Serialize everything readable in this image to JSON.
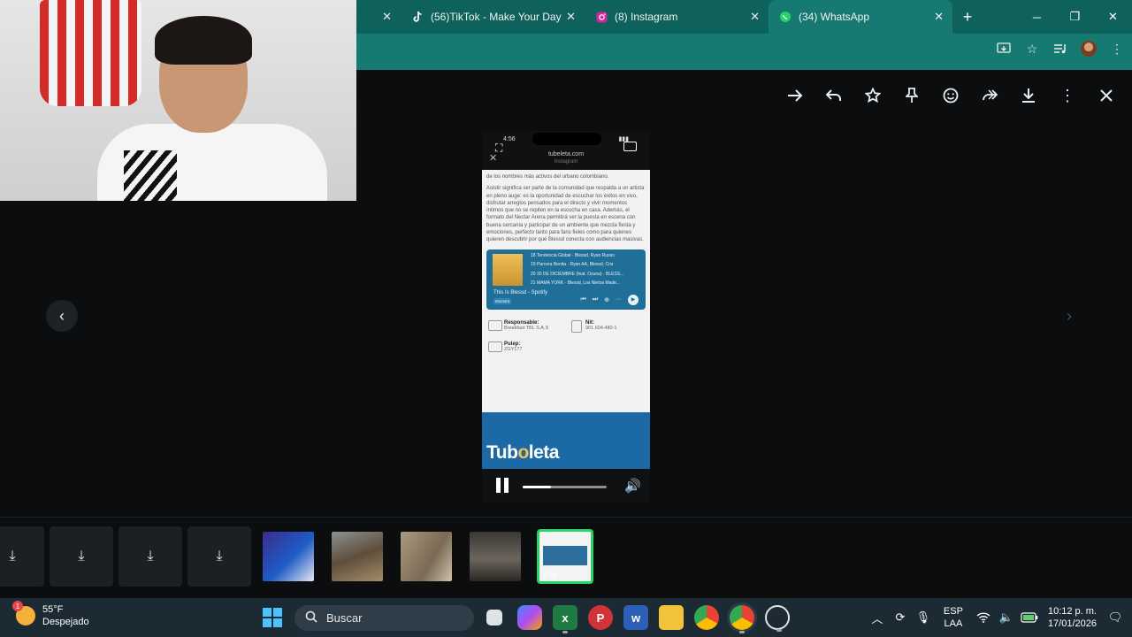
{
  "browser": {
    "tabs": [
      {
        "label": "",
        "icon": "tab-partial",
        "close": "✕"
      },
      {
        "label": "(56)TikTok - Make Your Day",
        "icon": "tiktok-icon",
        "close": "✕"
      },
      {
        "label": "(8) Instagram",
        "icon": "instagram-icon",
        "close": "✕"
      },
      {
        "label": "(34) WhatsApp",
        "icon": "whatsapp-icon",
        "close": "✕",
        "active": true
      }
    ],
    "new_tab": "+",
    "window_controls": [
      "─",
      "❐",
      "✕"
    ]
  },
  "viewer": {
    "actions": [
      "arrow-right-icon",
      "reply-icon",
      "star-icon",
      "pin-icon",
      "emoji-icon",
      "forward-icon",
      "download-icon",
      "more-icon",
      "close-icon"
    ],
    "prev": "‹",
    "next": "›"
  },
  "video": {
    "status_time": "4:56",
    "url": "tubeleta.com",
    "url_sub": "Instagram",
    "para1": "de los nombres más activos del urbano colombiano.",
    "para2": "Asistir significa ser parte de la comunidad que respalda a un artista en pleno auge: es la oportunidad de escuchar los éxitos en vivo, disfrutar arreglos pensados para el directo y vivir momentos íntimos que no se repiten en la escucha en casa. Además, el formato del Nectar Arena permitirá ver la puesta en escena con buena cercanía y participar de un ambiente que mezcla fiesta y emociones, perfecto tanto para fans fieles como para quienes quieren descubrir por qué Blessd conecta con audiencias masivas.",
    "spotify": {
      "tracks": [
        "18  Tendencia Global · Blessd, Ryan Russo",
        "19  Parcera Bonita · Ryan AA, Blessd, Cris",
        "20  30 DE DICIEMBRE (feat. Ozuna) · BLESS...",
        "21  MAMA YORK · Blessd, Los Nietos Made..."
      ],
      "title": "This Is Blessd - Spotify",
      "badge": "Muestra"
    },
    "info": {
      "responsable_label": "Responsable:",
      "responsable_value": "Breakfast TBL S.A.S",
      "nit_label": "Nit:",
      "nit_value": "901.604.480-1",
      "pulep_label": "Pulep:",
      "pulep_value": "ZGY177"
    },
    "brand": "Tuboleta",
    "progress": 0.34
  },
  "thumbnails": [
    {
      "type": "download"
    },
    {
      "type": "download"
    },
    {
      "type": "download"
    },
    {
      "type": "download"
    },
    {
      "type": "image",
      "color": "#4b5cc4"
    },
    {
      "type": "image",
      "color": "#6d5e4b"
    },
    {
      "type": "image",
      "color": "#8d7f66"
    },
    {
      "type": "image",
      "color": "#4a4540"
    },
    {
      "type": "video",
      "duration": "0:38",
      "selected": true
    }
  ],
  "taskbar": {
    "weather_badge": "1",
    "temp": "55°F",
    "condition": "Despejado",
    "search_placeholder": "Buscar",
    "lang_top": "ESP",
    "lang_bottom": "LAA",
    "time": "10:12 p. m.",
    "date": "17/01/2026"
  }
}
